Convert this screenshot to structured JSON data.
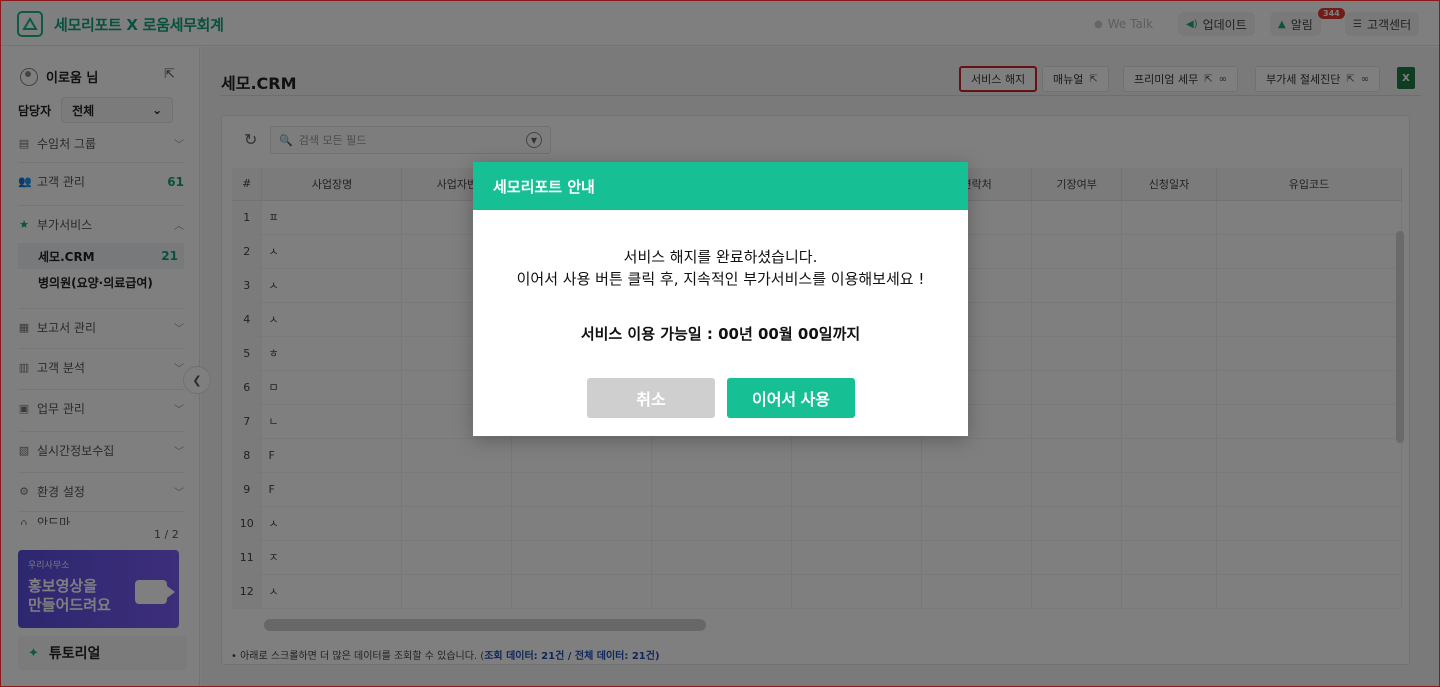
{
  "header": {
    "brand": "세모리포트 X 로움세무회계",
    "wetalk": "We Talk",
    "update": "업데이트",
    "alarm": "알림",
    "alarm_count": "344",
    "support": "고객센터"
  },
  "sidebar": {
    "user_name": "이로움 님",
    "manager_label": "담당자",
    "manager_value": "전체",
    "items": [
      {
        "label": "수임처 그룹"
      },
      {
        "label": "고객 관리",
        "count": "61"
      },
      {
        "label": "부가서비스"
      },
      {
        "label": "보고서 관리"
      },
      {
        "label": "고객 분석"
      },
      {
        "label": "업무 관리"
      },
      {
        "label": "실시간정보수집"
      },
      {
        "label": "환경 설정"
      },
      {
        "label": "안드마"
      }
    ],
    "sub_items": [
      {
        "label": "세모.CRM",
        "count": "21"
      },
      {
        "label": "병의원(요양·의료급여)"
      }
    ],
    "banner_page": "1 / 2",
    "banner_small": "우리사무소",
    "banner_line1": "홍보영상을",
    "banner_line2": "만들어드려요",
    "tutorial": "튜토리얼"
  },
  "main": {
    "title": "세모.CRM",
    "buttons": {
      "cancel_service": "서비스 해지",
      "manual": "매뉴얼",
      "premium": "프리미엄 세무",
      "vat": "부가세 절세진단"
    },
    "excel": "X",
    "search_placeholder": "검색 모든 필드",
    "columns": [
      "#",
      "사업장명",
      "사업자번",
      "연락처",
      "기장여부",
      "신청일자",
      "유입코드"
    ],
    "rows": [
      {
        "n": "1",
        "c": "ㅍ"
      },
      {
        "n": "2",
        "c": "ㅅ"
      },
      {
        "n": "3",
        "c": "ㅅ"
      },
      {
        "n": "4",
        "c": "ㅅ"
      },
      {
        "n": "5",
        "c": "ㅎ"
      },
      {
        "n": "6",
        "c": "ㅁ"
      },
      {
        "n": "7",
        "c": "ㄴ"
      },
      {
        "n": "8",
        "c": "F"
      },
      {
        "n": "9",
        "c": "F"
      },
      {
        "n": "10",
        "c": "ㅅ"
      },
      {
        "n": "11",
        "c": "ㅈ"
      },
      {
        "n": "12",
        "c": "ㅅ"
      }
    ],
    "footnote_prefix": "• 아래로 스크롤하면 더 많은 데이터를 조회할 수 있습니다. (",
    "footnote_counts": "조회 데이터: 21건 / 전체 데이터: 21건",
    "footnote_suffix": ")"
  },
  "modal": {
    "title": "세모리포트 안내",
    "line1": "서비스 해지를 완료하셨습니다.",
    "line2": "이어서 사용 버튼 클릭 후, 지속적인 부가서비스를 이용해보세요 !",
    "availability": "서비스 이용 가능일 : 00년 00월 00일까지",
    "cancel_label": "취소",
    "continue_label": "이어서 사용"
  },
  "colors": {
    "brand": "#17bf94",
    "highlight_border": "#c8252a",
    "badge": "#e23b2f"
  }
}
